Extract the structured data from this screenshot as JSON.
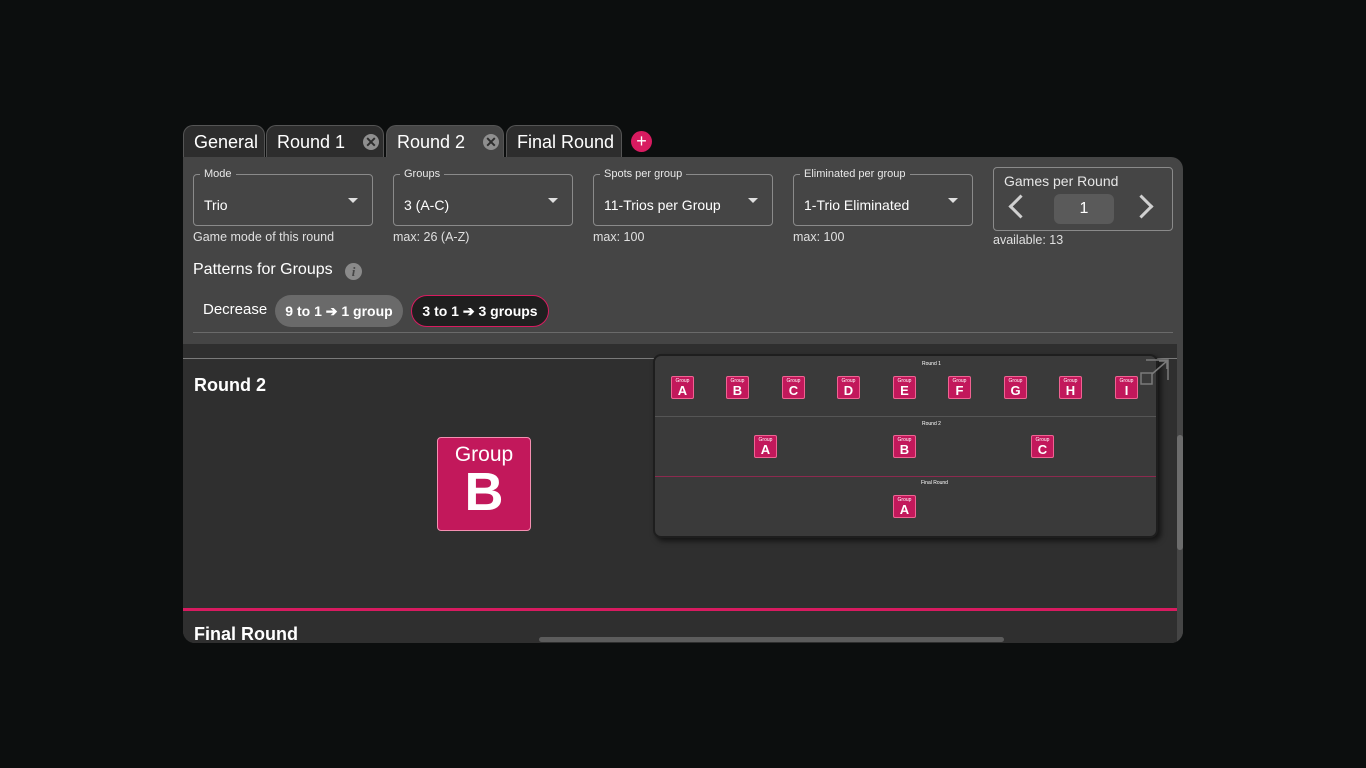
{
  "tabs": [
    {
      "label": "General",
      "active": false,
      "closable": false
    },
    {
      "label": "Round 1",
      "active": false,
      "closable": true
    },
    {
      "label": "Round 2",
      "active": true,
      "closable": true
    },
    {
      "label": "Final Round",
      "active": false,
      "closable": false
    }
  ],
  "add_tab_label": "+",
  "close_glyph": "✕",
  "fields": {
    "mode": {
      "legend": "Mode",
      "value": "Trio",
      "helper": "Game mode of this round"
    },
    "groups": {
      "legend": "Groups",
      "value": "3 (A-C)",
      "helper": "max: 26 (A-Z)"
    },
    "spots": {
      "legend": "Spots per group",
      "value": "11-Trios per Group",
      "helper": "max: 100"
    },
    "eliminated": {
      "legend": "Eliminated per group",
      "value": "1-Trio Eliminated",
      "helper": "max: 100"
    }
  },
  "games_per_round": {
    "label": "Games per Round",
    "value": "1",
    "helper": "available: 13"
  },
  "patterns": {
    "title": "Patterns for Groups",
    "info_glyph": "i",
    "label": "Decrease",
    "chips": [
      "9 to 1 ➔ 1 group",
      "3 to 1 ➔ 3 groups"
    ],
    "selected_chip": 1
  },
  "section": {
    "title": "Round 2",
    "group_label": "Group",
    "group_letter": "B",
    "next_title": "Final Round"
  },
  "overview": {
    "rounds": [
      {
        "title": "Round 1",
        "groups": [
          "A",
          "B",
          "C",
          "D",
          "E",
          "F",
          "G",
          "H",
          "I"
        ]
      },
      {
        "title": "Round 2",
        "groups": [
          "A",
          "B",
          "C"
        ]
      },
      {
        "title": "Final Round",
        "groups": [
          "A"
        ]
      }
    ],
    "group_label": "Group"
  },
  "colors": {
    "accent": "#d81b60",
    "group_bg": "#c2185b",
    "panel": "#454545",
    "background": "#0c0e0e"
  },
  "icons": [
    "close-icon",
    "add-icon",
    "chevron-down-icon",
    "chevron-left-icon",
    "chevron-right-icon",
    "info-icon",
    "expand-icon"
  ]
}
